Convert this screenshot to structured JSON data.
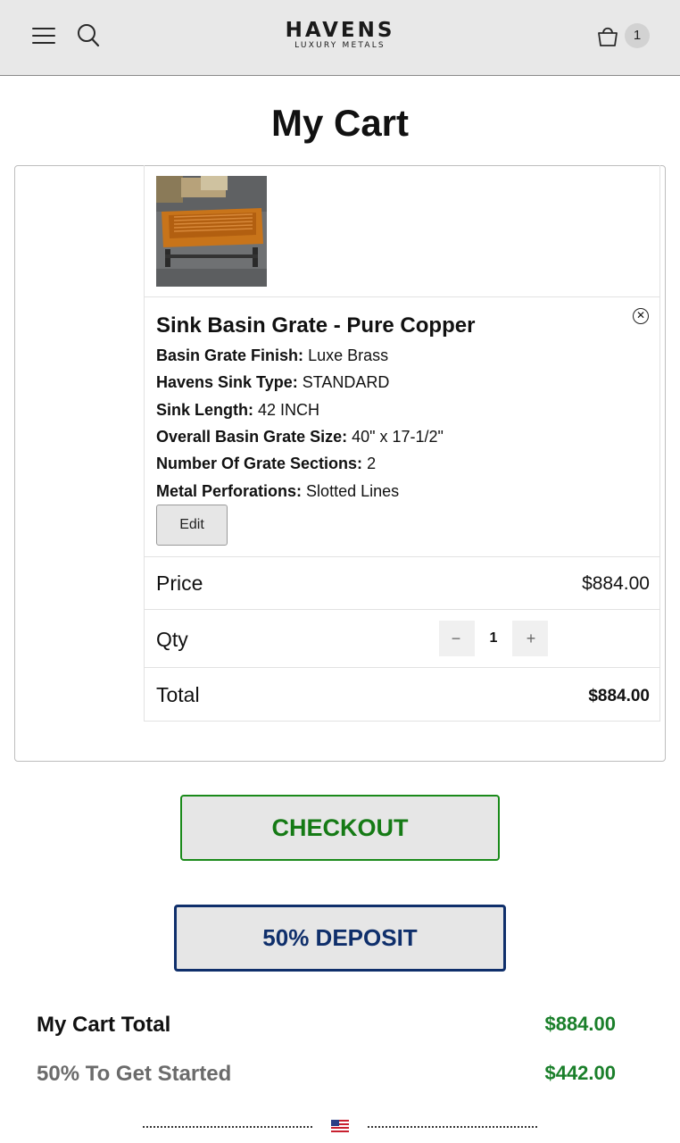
{
  "header": {
    "logo_main": "HAVENS",
    "logo_sub": "LUXURY METALS",
    "cart_count": "1"
  },
  "page": {
    "title": "My Cart"
  },
  "cart_item": {
    "name": "Sink Basin Grate - Pure Copper",
    "remove_glyph": "✕",
    "options": [
      {
        "label": "Basin Grate Finish:",
        "value": "Luxe Brass"
      },
      {
        "label": "Havens Sink Type:",
        "value": "STANDARD"
      },
      {
        "label": "Sink Length:",
        "value": "42 INCH"
      },
      {
        "label": "Overall Basin Grate Size:",
        "value": "40\" x 17-1/2\""
      },
      {
        "label": "Number Of Grate Sections:",
        "value": "2"
      },
      {
        "label": "Metal Perforations:",
        "value": "Slotted Lines"
      }
    ],
    "edit_label": "Edit",
    "price_label": "Price",
    "price_value": "$884.00",
    "qty_label": "Qty",
    "qty_value": "1",
    "qty_minus": "−",
    "qty_plus": "+",
    "total_label": "Total",
    "total_value": "$884.00"
  },
  "actions": {
    "checkout_label": "CHECKOUT",
    "deposit_label": "50% DEPOSIT"
  },
  "summary": {
    "cart_total_label": "My Cart Total",
    "cart_total_value": "$884.00",
    "deposit_label": "50% To Get Started",
    "deposit_value": "$442.00"
  },
  "colors": {
    "checkout_green": "#157a15",
    "deposit_navy": "#0f2f6b",
    "summary_green": "#1a7f2a",
    "header_bg": "#e8e8e8"
  },
  "icons": [
    "menu-icon",
    "search-icon",
    "shopping-bag-icon",
    "close-circle-icon",
    "us-flag-icon"
  ]
}
